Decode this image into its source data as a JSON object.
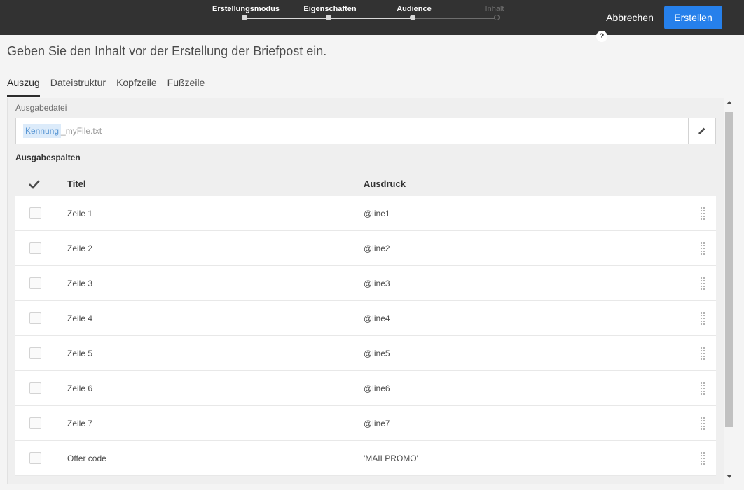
{
  "wizard": {
    "steps": [
      {
        "label": "Erstellungsmodus",
        "state": "done"
      },
      {
        "label": "Eigenschaften",
        "state": "done"
      },
      {
        "label": "Audience",
        "state": "done"
      },
      {
        "label": "Inhalt",
        "state": "current"
      }
    ]
  },
  "header": {
    "cancel_label": "Abbrechen",
    "create_label": "Erstellen",
    "help_icon": "?"
  },
  "page": {
    "title": "Geben Sie den Inhalt vor der Erstellung der Briefpost ein."
  },
  "tabs": [
    {
      "label": "Auszug",
      "active": true
    },
    {
      "label": "Dateistruktur",
      "active": false
    },
    {
      "label": "Kopfzeile",
      "active": false
    },
    {
      "label": "Fußzeile",
      "active": false
    }
  ],
  "output_file": {
    "label": "Ausgabedatei",
    "token": "Kennung",
    "suffix": "_myFile.txt"
  },
  "output_columns": {
    "label": "Ausgabespalten",
    "headers": {
      "title": "Titel",
      "expression": "Ausdruck"
    },
    "rows": [
      {
        "title": "Zeile 1",
        "expression": "@line1"
      },
      {
        "title": "Zeile 2",
        "expression": "@line2"
      },
      {
        "title": "Zeile 3",
        "expression": "@line3"
      },
      {
        "title": "Zeile 4",
        "expression": "@line4"
      },
      {
        "title": "Zeile 5",
        "expression": "@line5"
      },
      {
        "title": "Zeile 6",
        "expression": "@line6"
      },
      {
        "title": "Zeile 7",
        "expression": "@line7"
      },
      {
        "title": "Offer code",
        "expression": "'MAILPROMO'"
      }
    ]
  },
  "colors": {
    "topbar": "#323232",
    "primary_button": "#2680eb",
    "token_bg": "#dcebfa"
  }
}
